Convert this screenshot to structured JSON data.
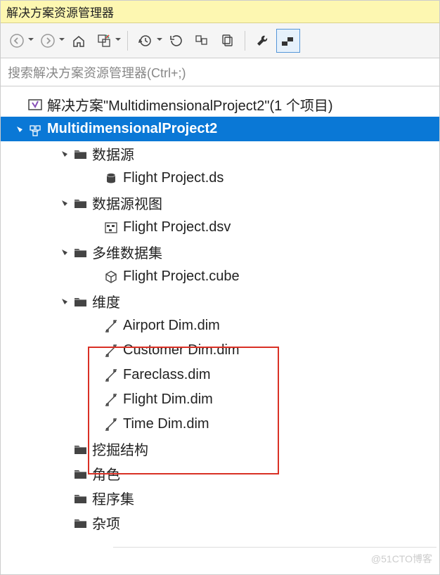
{
  "title": "解决方案资源管理器",
  "search_placeholder": "搜索解决方案资源管理器(Ctrl+;)",
  "solution": {
    "label": "解决方案\"MultidimensionalProject2\"(1 个项目)",
    "project": "MultidimensionalProject2",
    "folders": {
      "data_sources": {
        "label": "数据源",
        "items": [
          "Flight Project.ds"
        ]
      },
      "data_source_views": {
        "label": "数据源视图",
        "items": [
          "Flight Project.dsv"
        ]
      },
      "cubes": {
        "label": "多维数据集",
        "items": [
          "Flight Project.cube"
        ]
      },
      "dimensions": {
        "label": "维度",
        "items": [
          "Airport Dim.dim",
          "Customer Dim.dim",
          "Fareclass.dim",
          "Flight Dim.dim",
          "Time Dim.dim"
        ]
      },
      "mining": {
        "label": "挖掘结构"
      },
      "roles": {
        "label": "角色"
      },
      "assemblies": {
        "label": "程序集"
      },
      "misc": {
        "label": "杂项"
      }
    }
  },
  "watermark": "@51CTO博客"
}
